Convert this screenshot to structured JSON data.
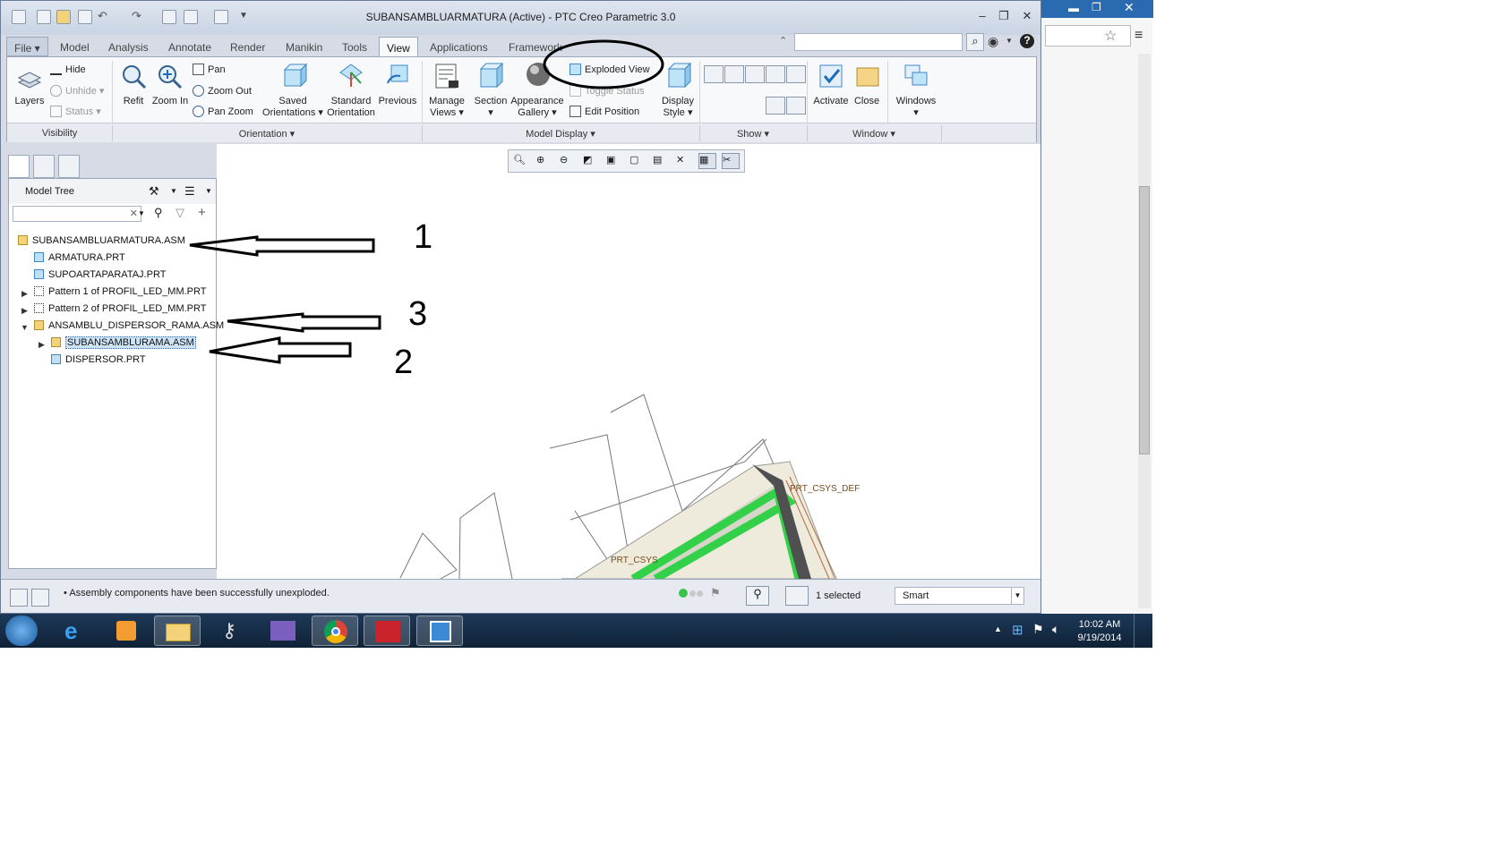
{
  "app": {
    "title": "SUBANSAMBLUARMATURA (Active) - PTC Creo Parametric 3.0"
  },
  "tabs": [
    "File",
    "Model",
    "Analysis",
    "Annotate",
    "Render",
    "Manikin",
    "Tools",
    "View",
    "Applications",
    "Framework"
  ],
  "active_tab": "View",
  "ribbon": {
    "visibility": {
      "layers": "Layers",
      "hide": "Hide",
      "unhide": "Unhide",
      "status": "Status",
      "group": "Visibility"
    },
    "orientation": {
      "refit": "Refit",
      "zoom_in": "Zoom In",
      "pan": "Pan",
      "zoom_out": "Zoom Out",
      "pan_zoom": "Pan Zoom",
      "saved_1": "Saved",
      "saved_2": "Orientations",
      "standard_1": "Standard",
      "standard_2": "Orientation",
      "previous": "Previous",
      "group": "Orientation"
    },
    "model_display": {
      "manage_1": "Manage",
      "manage_2": "Views",
      "section": "Section",
      "appearance_1": "Appearance",
      "appearance_2": "Gallery",
      "exploded_view": "Exploded View",
      "toggle_status": "Toggle Status",
      "edit_position": "Edit Position",
      "display_1": "Display",
      "display_2": "Style",
      "group": "Model Display"
    },
    "show": {
      "group": "Show"
    },
    "window": {
      "activate": "Activate",
      "close": "Close",
      "windows": "Windows",
      "group": "Window"
    }
  },
  "tree": {
    "title": "Model Tree",
    "items": [
      {
        "label": "SUBANSAMBLUARMATURA.ASM"
      },
      {
        "label": "ARMATURA.PRT"
      },
      {
        "label": "SUPOARTAPARATAJ.PRT"
      },
      {
        "label": "Pattern 1 of PROFIL_LED_MM.PRT"
      },
      {
        "label": "Pattern 2 of PROFIL_LED_MM.PRT"
      },
      {
        "label": "ANSAMBLU_DISPERSOR_RAMA.ASM"
      },
      {
        "label": "SUBANSAMBLURAMA.ASM"
      },
      {
        "label": "DISPERSOR.PRT"
      }
    ]
  },
  "graphics": {
    "csys_1": "PRT_CSYS_DEF",
    "csys_2": "PRT_CSYS"
  },
  "status": {
    "message": "Assembly components have been successfully unexploded.",
    "selected": "1 selected",
    "filter": "Smart"
  },
  "annotations": [
    "1",
    "3",
    "2"
  ],
  "taskbar": {
    "time": "10:02 AM",
    "date": "9/19/2014"
  }
}
